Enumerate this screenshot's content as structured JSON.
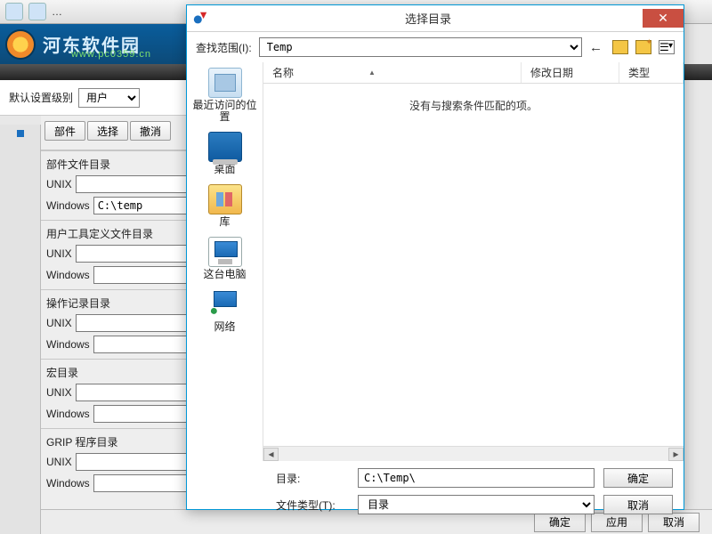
{
  "bg": {
    "toolbar_hint": "…",
    "watermark_text": "河东软件园",
    "watermark_url": "www.pc0359.cn",
    "level_label": "默认设置级别",
    "level_value": "用户",
    "tabs": {
      "parts": "部件",
      "select": "选择",
      "undo": "撤消"
    },
    "sections": [
      {
        "title": "部件文件目录",
        "unix": "",
        "windows": "C:\\temp"
      },
      {
        "title": "用户工具定义文件目录",
        "unix": "",
        "windows": ""
      },
      {
        "title": "操作记录目录",
        "unix": "",
        "windows": ""
      },
      {
        "title": "宏目录",
        "unix": "",
        "windows": ""
      },
      {
        "title": "GRIP 程序目录",
        "unix": "",
        "windows": ""
      }
    ],
    "row_labels": {
      "unix": "UNIX",
      "windows": "Windows"
    },
    "bottom": {
      "ok": "确定",
      "apply": "应用",
      "cancel": "取消"
    }
  },
  "dialog": {
    "title": "选择目录",
    "look_in_label": "查找范围(I):",
    "look_in_value": "Temp",
    "places": {
      "recent": "最近访问的位置",
      "desktop": "桌面",
      "libraries": "库",
      "this_pc": "这台电脑",
      "network": "网络"
    },
    "columns": {
      "name": "名称",
      "modified": "修改日期",
      "type": "类型"
    },
    "empty_text": "没有与搜索条件匹配的项。",
    "dir_label": "目录:",
    "dir_value": "C:\\Temp\\",
    "type_label": "文件类型(T):",
    "type_value": "目录",
    "ok": "确定",
    "cancel": "取消"
  }
}
